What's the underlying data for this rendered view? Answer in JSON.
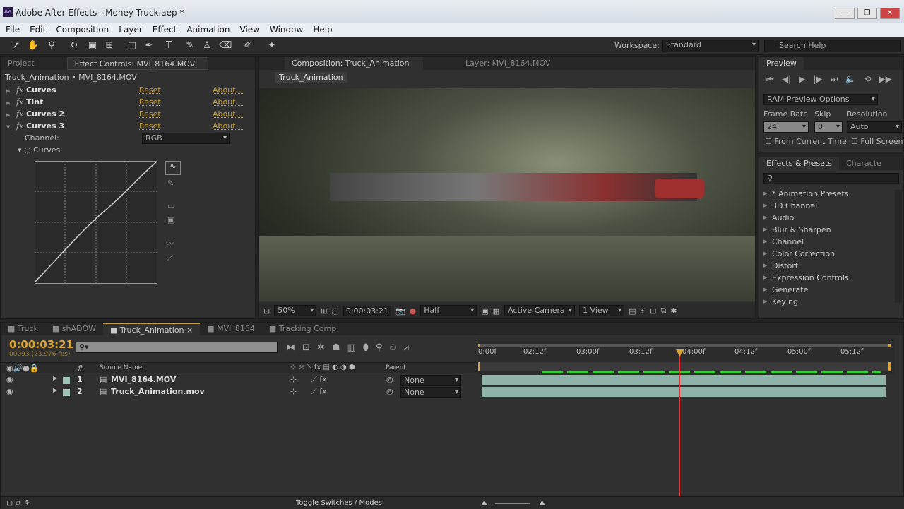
{
  "window": {
    "title": "Adobe After Effects - Money Truck.aep *",
    "logo": "Ae",
    "minimize": "—",
    "restore": "❐",
    "close": "✕"
  },
  "menu": [
    "File",
    "Edit",
    "Composition",
    "Layer",
    "Effect",
    "Animation",
    "View",
    "Window",
    "Help"
  ],
  "toolbar": {
    "workspace_label": "Workspace:",
    "workspace_value": "Standard",
    "search_placeholder": "Search Help"
  },
  "effect_controls": {
    "tab_project": "Project",
    "tab_title": "Effect Controls: MVI_8164.MOV",
    "breadcrumb": "Truck_Animation • MVI_8164.MOV",
    "effects": [
      {
        "name": "Curves",
        "reset": "Reset",
        "about": "About..."
      },
      {
        "name": "Tint",
        "reset": "Reset",
        "about": "About..."
      },
      {
        "name": "Curves 2",
        "reset": "Reset",
        "about": "About..."
      },
      {
        "name": "Curves 3",
        "reset": "Reset",
        "about": "About..."
      }
    ],
    "fx_glyph": "fx",
    "channel_label": "Channel:",
    "channel_value": "RGB",
    "curves_label": "Curves"
  },
  "composition": {
    "tab_title": "Composition: Truck_Animation",
    "layer_tab": "Layer: MVI_8164.MOV",
    "comp_chip": "Truck_Animation",
    "zoom": "50%",
    "timecode": "0:00:03:21",
    "resolution": "Half",
    "camera": "Active Camera",
    "views": "1 View"
  },
  "preview": {
    "title": "Preview",
    "ram_options": "RAM Preview Options",
    "frame_rate_label": "Frame Rate",
    "skip_label": "Skip",
    "resolution_label": "Resolution",
    "frame_rate": "24",
    "skip": "0",
    "resolution": "Auto",
    "from_current": "From Current Time",
    "full_screen": "Full Screen"
  },
  "effects_presets": {
    "title": "Effects & Presets",
    "tab2": "Characte",
    "items": [
      "* Animation Presets",
      "3D Channel",
      "Audio",
      "Blur & Sharpen",
      "Channel",
      "Color Correction",
      "Distort",
      "Expression Controls",
      "Generate",
      "Keying"
    ]
  },
  "timeline": {
    "tabs": [
      "Truck",
      "shADOW",
      "Truck_Animation",
      "MVI_8164",
      "Tracking Comp"
    ],
    "active_tab": 2,
    "timecode": "0:00:03:21",
    "frame_info": "00093 (23.976 fps)",
    "col_number": "#",
    "col_source": "Source Name",
    "col_parent": "Parent",
    "layers": [
      {
        "num": "1",
        "name": "MVI_8164.MOV",
        "parent": "None"
      },
      {
        "num": "2",
        "name": "Truck_Animation.mov",
        "parent": "None"
      }
    ],
    "ruler": [
      "0:00f",
      "02:12f",
      "03:00f",
      "03:12f",
      "04:00f",
      "04:12f",
      "05:00f",
      "05:12f"
    ],
    "toggle": "Toggle Switches / Modes"
  },
  "colors": {
    "accent": "#c8a23c",
    "layer_bar": "#8fb3a8",
    "playhead": "#d33"
  }
}
